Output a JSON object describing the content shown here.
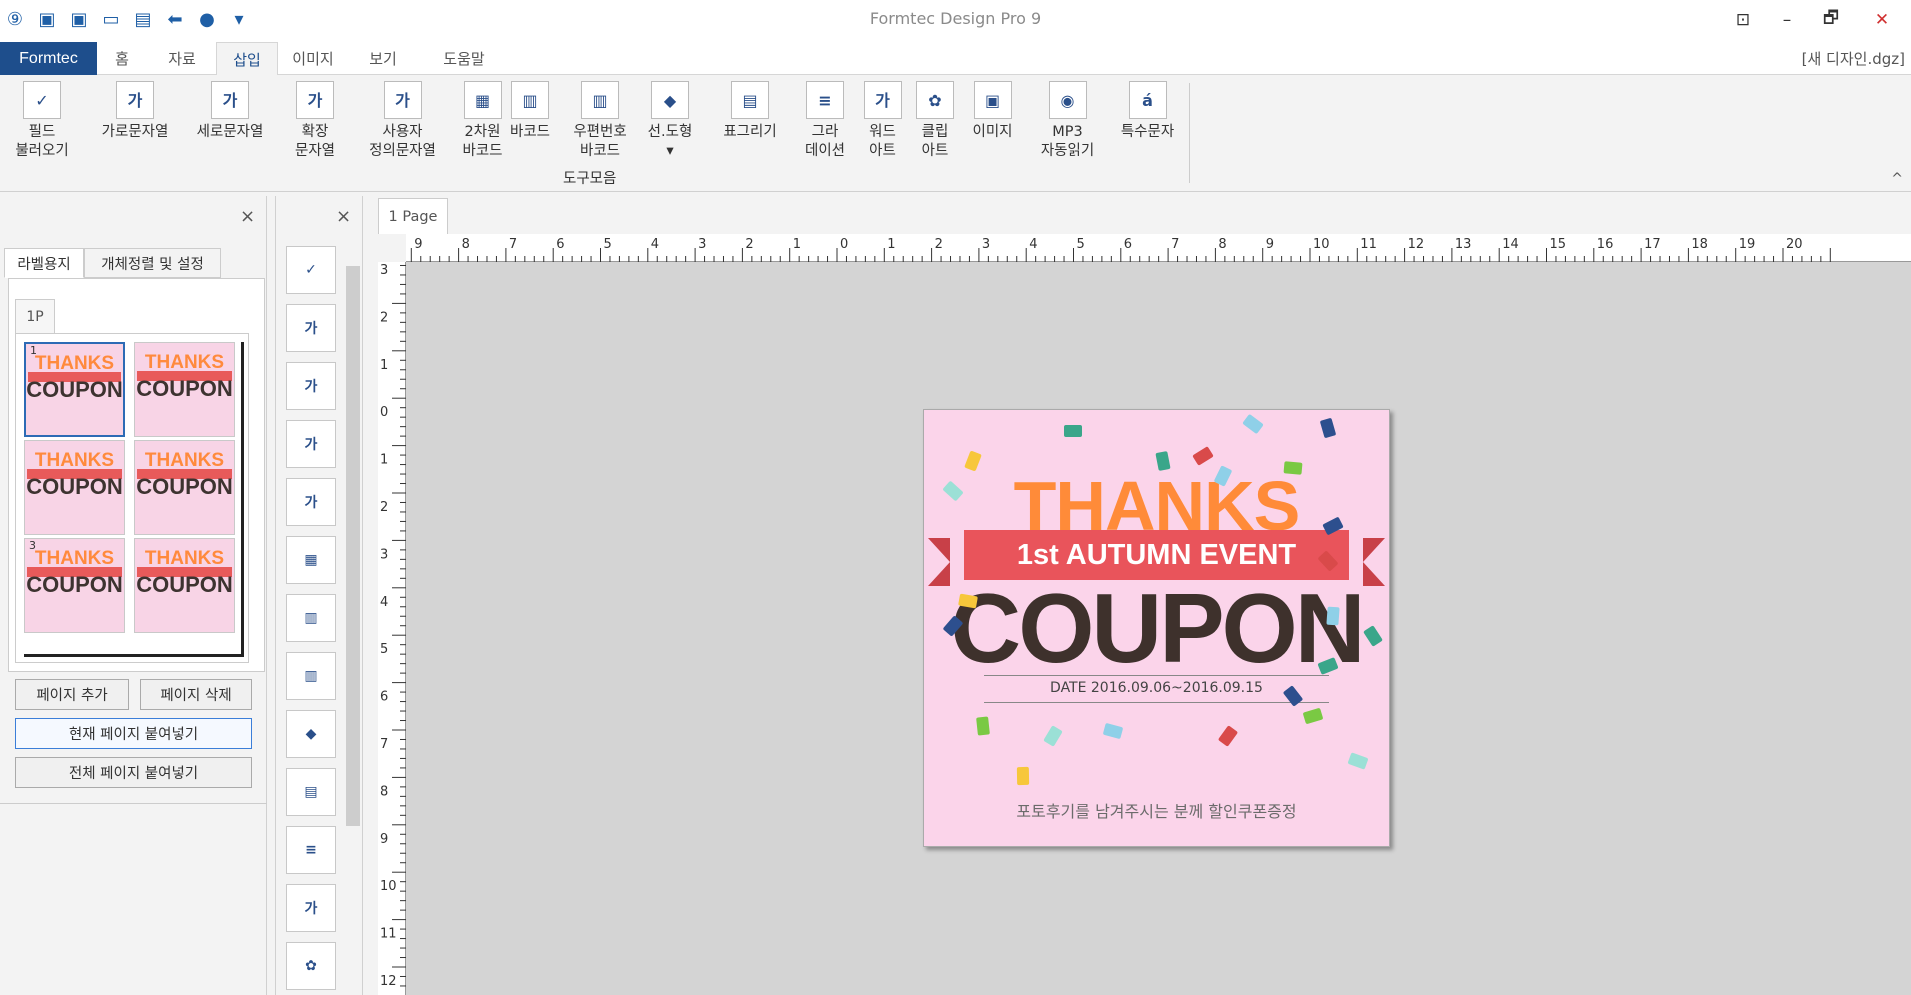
{
  "app": {
    "title": "Formtec Design Pro 9",
    "document": "[새 디자인.dgz]",
    "app_tab": "Formtec"
  },
  "window_controls": {
    "pin": "⊡",
    "minimize": "–",
    "restore": "🗗",
    "close": "✕"
  },
  "quick_access": [
    "app-logo-icon",
    "save-icon",
    "save-as-icon",
    "open-folder-icon",
    "print-preview-icon",
    "undo-icon",
    "color-icon",
    "dropdown-icon"
  ],
  "tabs": [
    "홈",
    "자료",
    "삽입",
    "이미지",
    "보기",
    "도움말"
  ],
  "active_tab": "삽입",
  "ribbon": {
    "group_label": "도구모음",
    "buttons": [
      {
        "l1": "필드",
        "l2": "불러오기",
        "icon": "field-load-icon",
        "g": "✓"
      },
      {
        "l1": "가로문자열",
        "l2": "",
        "icon": "horizontal-text-icon",
        "g": "가"
      },
      {
        "l1": "세로문자열",
        "l2": "",
        "icon": "vertical-text-icon",
        "g": "가"
      },
      {
        "l1": "확장",
        "l2": "문자열",
        "icon": "extended-text-icon",
        "g": "가"
      },
      {
        "l1": "사용자",
        "l2": "정의문자열",
        "icon": "custom-text-icon",
        "g": "가"
      },
      {
        "l1": "2차원",
        "l2": "바코드",
        "icon": "qr-code-icon",
        "g": "▦"
      },
      {
        "l1": "바코드",
        "l2": "",
        "icon": "barcode-icon",
        "g": "▥"
      },
      {
        "l1": "우편번호",
        "l2": "바코드",
        "icon": "postal-barcode-icon",
        "g": "▥"
      },
      {
        "l1": "선.도형",
        "l2": "▾",
        "icon": "shape-icon",
        "g": "◆"
      },
      {
        "l1": "표그리기",
        "l2": "",
        "icon": "table-icon",
        "g": "▤"
      },
      {
        "l1": "그라",
        "l2": "데이션",
        "icon": "gradation-icon",
        "g": "≡"
      },
      {
        "l1": "워드",
        "l2": "아트",
        "icon": "wordart-icon",
        "g": "가"
      },
      {
        "l1": "클립",
        "l2": "아트",
        "icon": "clipart-icon",
        "g": "✿"
      },
      {
        "l1": "이미지",
        "l2": "",
        "icon": "image-icon",
        "g": "▣"
      },
      {
        "l1": "MP3",
        "l2": "자동읽기",
        "icon": "mp3-icon",
        "g": "◉"
      },
      {
        "l1": "특수문자",
        "l2": "",
        "icon": "special-char-icon",
        "g": "á"
      }
    ],
    "collapse": "^"
  },
  "left_panel": {
    "close": "×",
    "tabs": [
      "라벨용지",
      "개체정렬 및 설정"
    ],
    "page_tab": "1P",
    "thumb": {
      "thanks": "THANKS",
      "coupon": "COUPON"
    },
    "thumb_rows": [
      "1",
      "",
      "3"
    ],
    "buttons": {
      "add": "페이지 추가",
      "delete": "페이지 삭제",
      "paste_current": "현재 페이지 붙여넣기",
      "paste_all": "전체 페이지 붙여넣기"
    }
  },
  "tool_strip": {
    "close": "×",
    "tools": [
      {
        "icon": "field-load-icon",
        "g": "✓"
      },
      {
        "icon": "horizontal-text-icon",
        "g": "가"
      },
      {
        "icon": "vertical-text-icon",
        "g": "가"
      },
      {
        "icon": "extended-text-icon",
        "g": "가"
      },
      {
        "icon": "custom-text-icon",
        "g": "가"
      },
      {
        "icon": "qr-code-icon",
        "g": "▦"
      },
      {
        "icon": "barcode-icon",
        "g": "▥"
      },
      {
        "icon": "postal-barcode-icon",
        "g": "▥"
      },
      {
        "icon": "shape-icon",
        "g": "◆"
      },
      {
        "icon": "table-icon",
        "g": "▤"
      },
      {
        "icon": "gradation-icon",
        "g": "≡"
      },
      {
        "icon": "wordart-icon",
        "g": "가"
      },
      {
        "icon": "clipart-icon",
        "g": "✿"
      }
    ]
  },
  "canvas": {
    "page_tab": "1 Page",
    "hruler": [
      "10",
      "9",
      "8",
      "7",
      "6",
      "5",
      "4",
      "3",
      "2",
      "1",
      "0",
      "1",
      "2",
      "3",
      "4",
      "5",
      "6",
      "7",
      "8",
      "9",
      "10",
      "11",
      "12",
      "13",
      "14",
      "15",
      "16",
      "17",
      "18",
      "19",
      "20"
    ],
    "vruler": [
      "3",
      "2",
      "1",
      "0",
      "1",
      "2",
      "3",
      "4",
      "5",
      "6",
      "7",
      "8",
      "9",
      "10",
      "11",
      "12"
    ]
  },
  "label": {
    "thanks": "THANKS",
    "event": "1st AUTUMN EVENT",
    "coupon": "COUPON",
    "date": "DATE 2016.09.06~2016.09.15",
    "footer": "포토후기를 남겨주시는 분께 할인쿠폰증정"
  },
  "colors": {
    "accent": "#1e4e8c",
    "label_bg": "#fbd4ea",
    "thanks": "#ff8b39",
    "ribbon": "#e9545b",
    "coupon": "#3e312c"
  }
}
